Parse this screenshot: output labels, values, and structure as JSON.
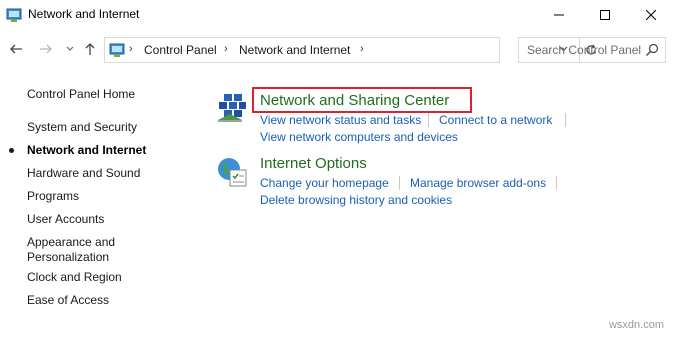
{
  "window": {
    "title": "Network and Internet",
    "controls": {
      "minimize": "minimize-icon",
      "maximize": "maximize-icon",
      "close": "close-icon"
    }
  },
  "address": {
    "breadcrumbs": [
      "Control Panel",
      "Network and Internet"
    ],
    "search_placeholder": "Search Control Panel"
  },
  "sidebar": {
    "home": "Control Panel Home",
    "items": [
      "System and Security",
      "Network and Internet",
      "Hardware and Sound",
      "Programs",
      "User Accounts",
      "Appearance and",
      "Personalization",
      "Clock and Region",
      "Ease of Access"
    ],
    "active": "Network and Internet"
  },
  "categories": [
    {
      "title": "Network and Sharing Center",
      "links": [
        "View network status and tasks",
        "Connect to a network",
        "View network computers and devices"
      ]
    },
    {
      "title": "Internet Options",
      "links": [
        "Change your homepage",
        "Manage browser add-ons",
        "Delete browsing history and cookies"
      ]
    }
  ],
  "watermark": "wsxdn.com",
  "colors": {
    "link": "#1a5fb4",
    "category": "#1e6e1e",
    "highlight": "#d9232e"
  }
}
